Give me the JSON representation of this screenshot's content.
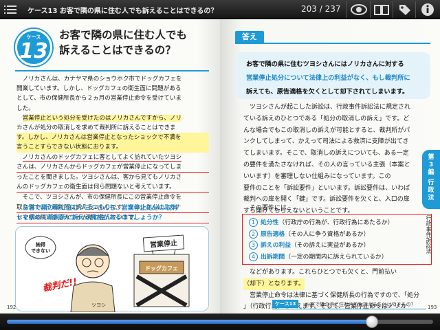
{
  "app": {
    "title": "ケース13 お客で隣の県に住む人でも訴えることはできるの？",
    "page_indicator": "203 / 237",
    "progress": 0.857
  },
  "left_page": {
    "case_label": "ケース",
    "case_number": "13",
    "title_line1": "お客で隣の県に住む人でも",
    "title_line2": "訴えることはできるの？",
    "paragraphs": [
      "ノリカさんは、カナヤマ県のショウホク市でドッグカフェを",
      "開業しています。しかし、ドッグカフェの衛生面に問題がある",
      "として、市の保健所長から２ヵ月の営業停止命令を受けていま",
      "した。",
      "営業停止という処分を受けたのはノリカさんですから、ノリ",
      "カさんが処分の取消しを求めて裁判所に訴えることはできま",
      "す。しかし、ノリカさんは営業停止となったショックで不満を",
      "言うことすらできない状態におります。",
      "ノリカさんのドッグカフェに客としてよく訪れていたツヨシ",
      "さんは、ノリカさんからドッグカフェが営業停止になってしま",
      "ったことを聞きました。ツヨシさんは、客から見てもノリカさ",
      "んのドッグカフェの衛生面は何ら問題ないと考えています。",
      "そこで、ツヨシさんが、市の保健所長にこの営業停止命令を",
      "取り消すよう裁判所に訴えるつもりです。ツヨシさんは、カナ",
      "ヤマ県の隣にあるカワオカ県に住んでいます。"
    ],
    "summary_line1": "お客で隣の県に住むツヨシさんも、営業停止処分の取消",
    "summary_line2": "しを求めて裁判所に訴える資格があるのでしょうか？",
    "bubble_text": "納得できない",
    "sign_text": "営業停止",
    "shop_text": "ドッグカフェ",
    "shout_text": "裁判だ!!",
    "character_name": "ツヨシ",
    "page_number": "192"
  },
  "right_page": {
    "answer_label": "答え",
    "answer_lines": [
      "お客で隣の県に住むツヨシさんにはノリカさんに対する",
      "営業停止処分について法律上の利益がなく、もし裁判所に",
      "訴えても、原告適格を欠くとして却下されてしまいます。"
    ],
    "body_lines": [
      "ツヨシさんが起こした訴訟は、行政事件訴訟法に規定され",
      "ている訴えのひとつである「処分の取消しの訴え」です。ど",
      "んな場合でもこの取消しの訴えが可能とすると、裁判所がパ",
      "ンクしてしまって、かえって司法による救済に支障が出てき",
      "てしまいます。そこで、取消しの訴えについても、ある一定",
      "の要件を満たさなければ、その人の言っている主張（本案と",
      "いいます）を審理しない仕組みになっています。この",
      "要件のことを「訴訟要件」といいます。訴訟要件は、いわば",
      "裁判への扉を開く「鍵」です。訴訟要件を欠くと、入口の扉",
      "すら開けてもらえないということです。",
      "その要件には、"
    ],
    "requirements": [
      {
        "num": "1",
        "key": "処分性",
        "desc": "（行政庁の行為が、行政行為にあたるか）"
      },
      {
        "num": "2",
        "key": "原告適格",
        "desc": "（その人に争う資格があるか）"
      },
      {
        "num": "3",
        "key": "訴えの利益",
        "desc": "（その訴えに実益があるか）"
      },
      {
        "num": "4",
        "key": "出訴期間",
        "desc": "（一定の期間内に訴えられているか）"
      }
    ],
    "after_lines": [
      "などがあります。これらひとつでも欠くと、門前払い",
      "（却下）となります。",
      "営業停止命令は法律に基づく保健所長の行為ですので、「処分",
      "」（行政行為）といえます。そして、営業停止命令はノリカ"
    ],
    "side_tab_lines": [
      "第",
      "3",
      "編",
      "行",
      "政",
      "法"
    ],
    "side_sub": "行政事件訴訟法",
    "footer_case": "ケース13",
    "footer_text": "お客で隣の県に住む人でも訴えることはできるの？",
    "page_number": "193"
  }
}
